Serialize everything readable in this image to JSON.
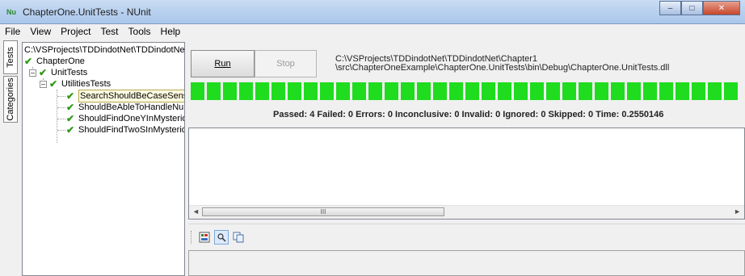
{
  "window": {
    "title": "ChapterOne.UnitTests - NUnit",
    "app_icon": "nunit-logo",
    "app_icon_text": "Nu"
  },
  "window_controls": {
    "minimize": "–",
    "maximize": "□",
    "close": "✕"
  },
  "menu": [
    "File",
    "View",
    "Project",
    "Test",
    "Tools",
    "Help"
  ],
  "side_tabs": [
    "Tests",
    "Categories"
  ],
  "tree": {
    "root": "C:\\VSProjects\\TDDindotNet\\TDDindotNet\\",
    "project": "ChapterOne",
    "namespace": "UnitTests",
    "fixture": "UtilitiesTests",
    "tests": [
      "SearchShouldBeCaseSensitive",
      "ShouldBeAbleToHandleNull",
      "ShouldFindOneYInMysteriou",
      "ShouldFindTwoSInMysteriou"
    ]
  },
  "buttons": {
    "run": "Run",
    "stop": "Stop"
  },
  "assembly_path": {
    "line1": "C:\\VSProjects\\TDDindotNet\\TDDindotNet\\Chapter1",
    "line2": "\\src\\ChapterOneExample\\ChapterOne.UnitTests\\bin\\Debug\\ChapterOne.UnitTests.dll"
  },
  "progress": {
    "fraction": 1.0,
    "color": "#1fdc1f"
  },
  "summary": "Passed: 4  Failed: 0  Errors: 0  Inconclusive: 0  Invalid: 0  Ignored: 0  Skipped: 0  Time: 0.2550146",
  "scrollbar": {
    "left": "◄",
    "right": "►",
    "thumb": "III"
  }
}
